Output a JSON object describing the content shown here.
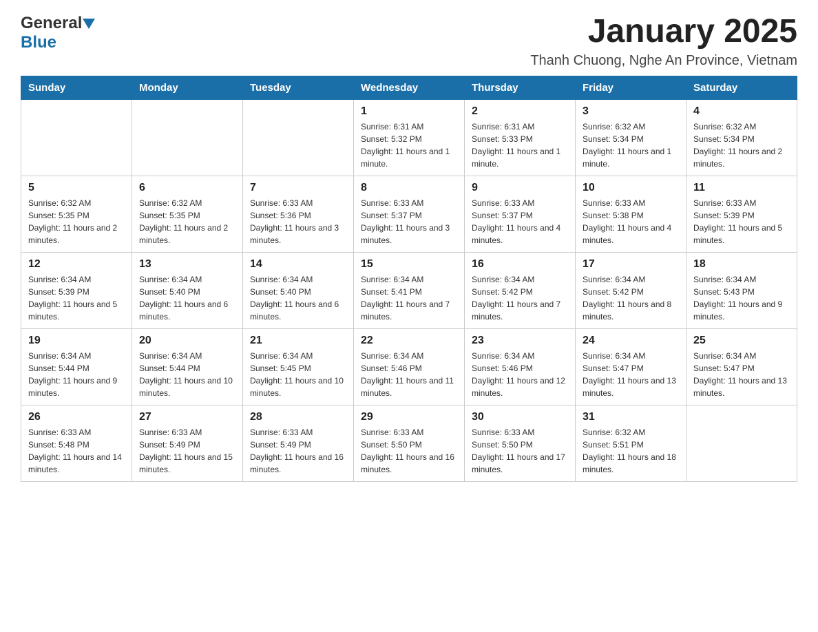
{
  "logo": {
    "text_general": "General",
    "triangle": "▲",
    "text_blue": "Blue"
  },
  "header": {
    "month_year": "January 2025",
    "location": "Thanh Chuong, Nghe An Province, Vietnam"
  },
  "days_of_week": [
    "Sunday",
    "Monday",
    "Tuesday",
    "Wednesday",
    "Thursday",
    "Friday",
    "Saturday"
  ],
  "weeks": [
    {
      "days": [
        {
          "number": "",
          "info": ""
        },
        {
          "number": "",
          "info": ""
        },
        {
          "number": "",
          "info": ""
        },
        {
          "number": "1",
          "info": "Sunrise: 6:31 AM\nSunset: 5:32 PM\nDaylight: 11 hours and 1 minute."
        },
        {
          "number": "2",
          "info": "Sunrise: 6:31 AM\nSunset: 5:33 PM\nDaylight: 11 hours and 1 minute."
        },
        {
          "number": "3",
          "info": "Sunrise: 6:32 AM\nSunset: 5:34 PM\nDaylight: 11 hours and 1 minute."
        },
        {
          "number": "4",
          "info": "Sunrise: 6:32 AM\nSunset: 5:34 PM\nDaylight: 11 hours and 2 minutes."
        }
      ]
    },
    {
      "days": [
        {
          "number": "5",
          "info": "Sunrise: 6:32 AM\nSunset: 5:35 PM\nDaylight: 11 hours and 2 minutes."
        },
        {
          "number": "6",
          "info": "Sunrise: 6:32 AM\nSunset: 5:35 PM\nDaylight: 11 hours and 2 minutes."
        },
        {
          "number": "7",
          "info": "Sunrise: 6:33 AM\nSunset: 5:36 PM\nDaylight: 11 hours and 3 minutes."
        },
        {
          "number": "8",
          "info": "Sunrise: 6:33 AM\nSunset: 5:37 PM\nDaylight: 11 hours and 3 minutes."
        },
        {
          "number": "9",
          "info": "Sunrise: 6:33 AM\nSunset: 5:37 PM\nDaylight: 11 hours and 4 minutes."
        },
        {
          "number": "10",
          "info": "Sunrise: 6:33 AM\nSunset: 5:38 PM\nDaylight: 11 hours and 4 minutes."
        },
        {
          "number": "11",
          "info": "Sunrise: 6:33 AM\nSunset: 5:39 PM\nDaylight: 11 hours and 5 minutes."
        }
      ]
    },
    {
      "days": [
        {
          "number": "12",
          "info": "Sunrise: 6:34 AM\nSunset: 5:39 PM\nDaylight: 11 hours and 5 minutes."
        },
        {
          "number": "13",
          "info": "Sunrise: 6:34 AM\nSunset: 5:40 PM\nDaylight: 11 hours and 6 minutes."
        },
        {
          "number": "14",
          "info": "Sunrise: 6:34 AM\nSunset: 5:40 PM\nDaylight: 11 hours and 6 minutes."
        },
        {
          "number": "15",
          "info": "Sunrise: 6:34 AM\nSunset: 5:41 PM\nDaylight: 11 hours and 7 minutes."
        },
        {
          "number": "16",
          "info": "Sunrise: 6:34 AM\nSunset: 5:42 PM\nDaylight: 11 hours and 7 minutes."
        },
        {
          "number": "17",
          "info": "Sunrise: 6:34 AM\nSunset: 5:42 PM\nDaylight: 11 hours and 8 minutes."
        },
        {
          "number": "18",
          "info": "Sunrise: 6:34 AM\nSunset: 5:43 PM\nDaylight: 11 hours and 9 minutes."
        }
      ]
    },
    {
      "days": [
        {
          "number": "19",
          "info": "Sunrise: 6:34 AM\nSunset: 5:44 PM\nDaylight: 11 hours and 9 minutes."
        },
        {
          "number": "20",
          "info": "Sunrise: 6:34 AM\nSunset: 5:44 PM\nDaylight: 11 hours and 10 minutes."
        },
        {
          "number": "21",
          "info": "Sunrise: 6:34 AM\nSunset: 5:45 PM\nDaylight: 11 hours and 10 minutes."
        },
        {
          "number": "22",
          "info": "Sunrise: 6:34 AM\nSunset: 5:46 PM\nDaylight: 11 hours and 11 minutes."
        },
        {
          "number": "23",
          "info": "Sunrise: 6:34 AM\nSunset: 5:46 PM\nDaylight: 11 hours and 12 minutes."
        },
        {
          "number": "24",
          "info": "Sunrise: 6:34 AM\nSunset: 5:47 PM\nDaylight: 11 hours and 13 minutes."
        },
        {
          "number": "25",
          "info": "Sunrise: 6:34 AM\nSunset: 5:47 PM\nDaylight: 11 hours and 13 minutes."
        }
      ]
    },
    {
      "days": [
        {
          "number": "26",
          "info": "Sunrise: 6:33 AM\nSunset: 5:48 PM\nDaylight: 11 hours and 14 minutes."
        },
        {
          "number": "27",
          "info": "Sunrise: 6:33 AM\nSunset: 5:49 PM\nDaylight: 11 hours and 15 minutes."
        },
        {
          "number": "28",
          "info": "Sunrise: 6:33 AM\nSunset: 5:49 PM\nDaylight: 11 hours and 16 minutes."
        },
        {
          "number": "29",
          "info": "Sunrise: 6:33 AM\nSunset: 5:50 PM\nDaylight: 11 hours and 16 minutes."
        },
        {
          "number": "30",
          "info": "Sunrise: 6:33 AM\nSunset: 5:50 PM\nDaylight: 11 hours and 17 minutes."
        },
        {
          "number": "31",
          "info": "Sunrise: 6:32 AM\nSunset: 5:51 PM\nDaylight: 11 hours and 18 minutes."
        },
        {
          "number": "",
          "info": ""
        }
      ]
    }
  ]
}
